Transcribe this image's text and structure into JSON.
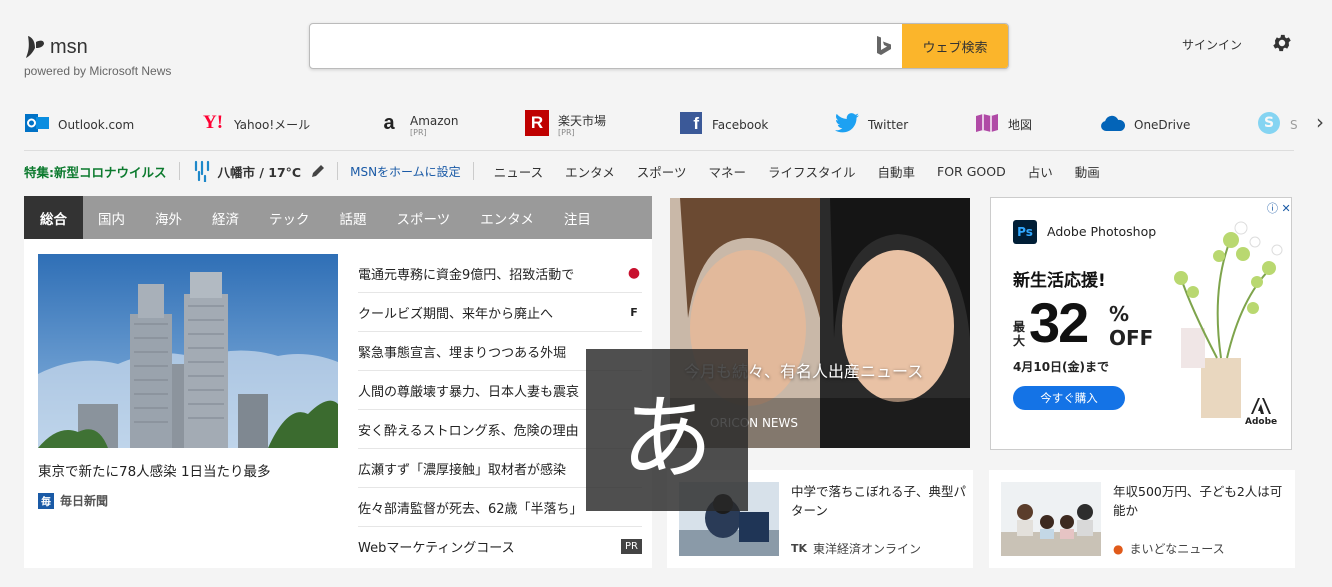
{
  "logo": {
    "text": "msn",
    "powered": "powered by Microsoft News"
  },
  "search": {
    "value": "",
    "placeholder": "",
    "button": "ウェブ検索"
  },
  "account": {
    "signin": "サインイン"
  },
  "shortcuts": [
    {
      "label": "Outlook.com",
      "pr": "",
      "icon": "outlook-icon",
      "color": "#0072c6"
    },
    {
      "label": "Yahoo!メール",
      "pr": "",
      "icon": "yahoo-icon",
      "color": "#ff0033"
    },
    {
      "label": "Amazon",
      "pr": "[PR]",
      "icon": "amazon-icon",
      "color": "#ff9900"
    },
    {
      "label": "楽天市場",
      "pr": "[PR]",
      "icon": "rakuten-icon",
      "color": "#bf0000"
    },
    {
      "label": "Facebook",
      "pr": "",
      "icon": "facebook-icon",
      "color": "#3b5998"
    },
    {
      "label": "Twitter",
      "pr": "",
      "icon": "twitter-icon",
      "color": "#1da1f2"
    },
    {
      "label": "地図",
      "pr": "",
      "icon": "map-icon",
      "color": "#9b2c8f"
    },
    {
      "label": "OneDrive",
      "pr": "",
      "icon": "onedrive-icon",
      "color": "#0364b8"
    },
    {
      "label": "S",
      "pr": "",
      "icon": "skype-icon",
      "color": "#00aff0"
    }
  ],
  "nav": {
    "corona": "特集:新型コロナウイルス",
    "weather": "八幡市 / 17°C",
    "msnhome": "MSNをホームに設定",
    "categories": [
      "ニュース",
      "エンタメ",
      "スポーツ",
      "マネー",
      "ライフスタイル",
      "自動車",
      "FOR GOOD",
      "占い",
      "動画"
    ]
  },
  "tabs": [
    "総合",
    "国内",
    "海外",
    "経済",
    "テック",
    "話題",
    "スポーツ",
    "エンタメ",
    "注目"
  ],
  "hero": {
    "caption": "東京で新たに78人感染 1日当たり最多",
    "source": "毎日新聞",
    "source_badge": "毎"
  },
  "headlines": [
    {
      "title": "電通元専務に資金9億円、招致活動で",
      "mark": "●"
    },
    {
      "title": "クールビズ期間、来年から廃止へ",
      "mark": "F"
    },
    {
      "title": "緊急事態宣言、埋まりつつある外堀",
      "mark": ""
    },
    {
      "title": "人間の尊厳壊す暴力、日本人妻も震哀",
      "mark": ""
    },
    {
      "title": "安く酔えるストロング系、危険の理由",
      "mark": ""
    },
    {
      "title": "広瀬すず「濃厚接触」取材者が感染",
      "mark": ""
    },
    {
      "title": "佐々部清監督が死去、62歳「半落ち」",
      "mark": ""
    },
    {
      "title": "Webマーケティングコース",
      "mark": "PR"
    }
  ],
  "feature": {
    "title": "今月も続々、有名人出産ニュース",
    "source": "ORICON NEWS"
  },
  "ad": {
    "brand": "Adobe Photoshop",
    "headline": "新生活応援!",
    "max": "最大",
    "percent": "32",
    "pct_sign": "%",
    "off": "OFF",
    "date": "4月10日(金)まで",
    "button": "今すぐ購入",
    "adobe": "Adobe",
    "info": "ⓘ ✕"
  },
  "cards": [
    {
      "title": "中学で落ちこぼれる子、典型パターン",
      "source": "東洋経済オンライン",
      "source_badge": "TK"
    },
    {
      "title": "年収500万円、子ども2人は可能か",
      "source": "まいどなニュース",
      "source_badge": "●"
    }
  ],
  "ime": {
    "char": "あ"
  }
}
